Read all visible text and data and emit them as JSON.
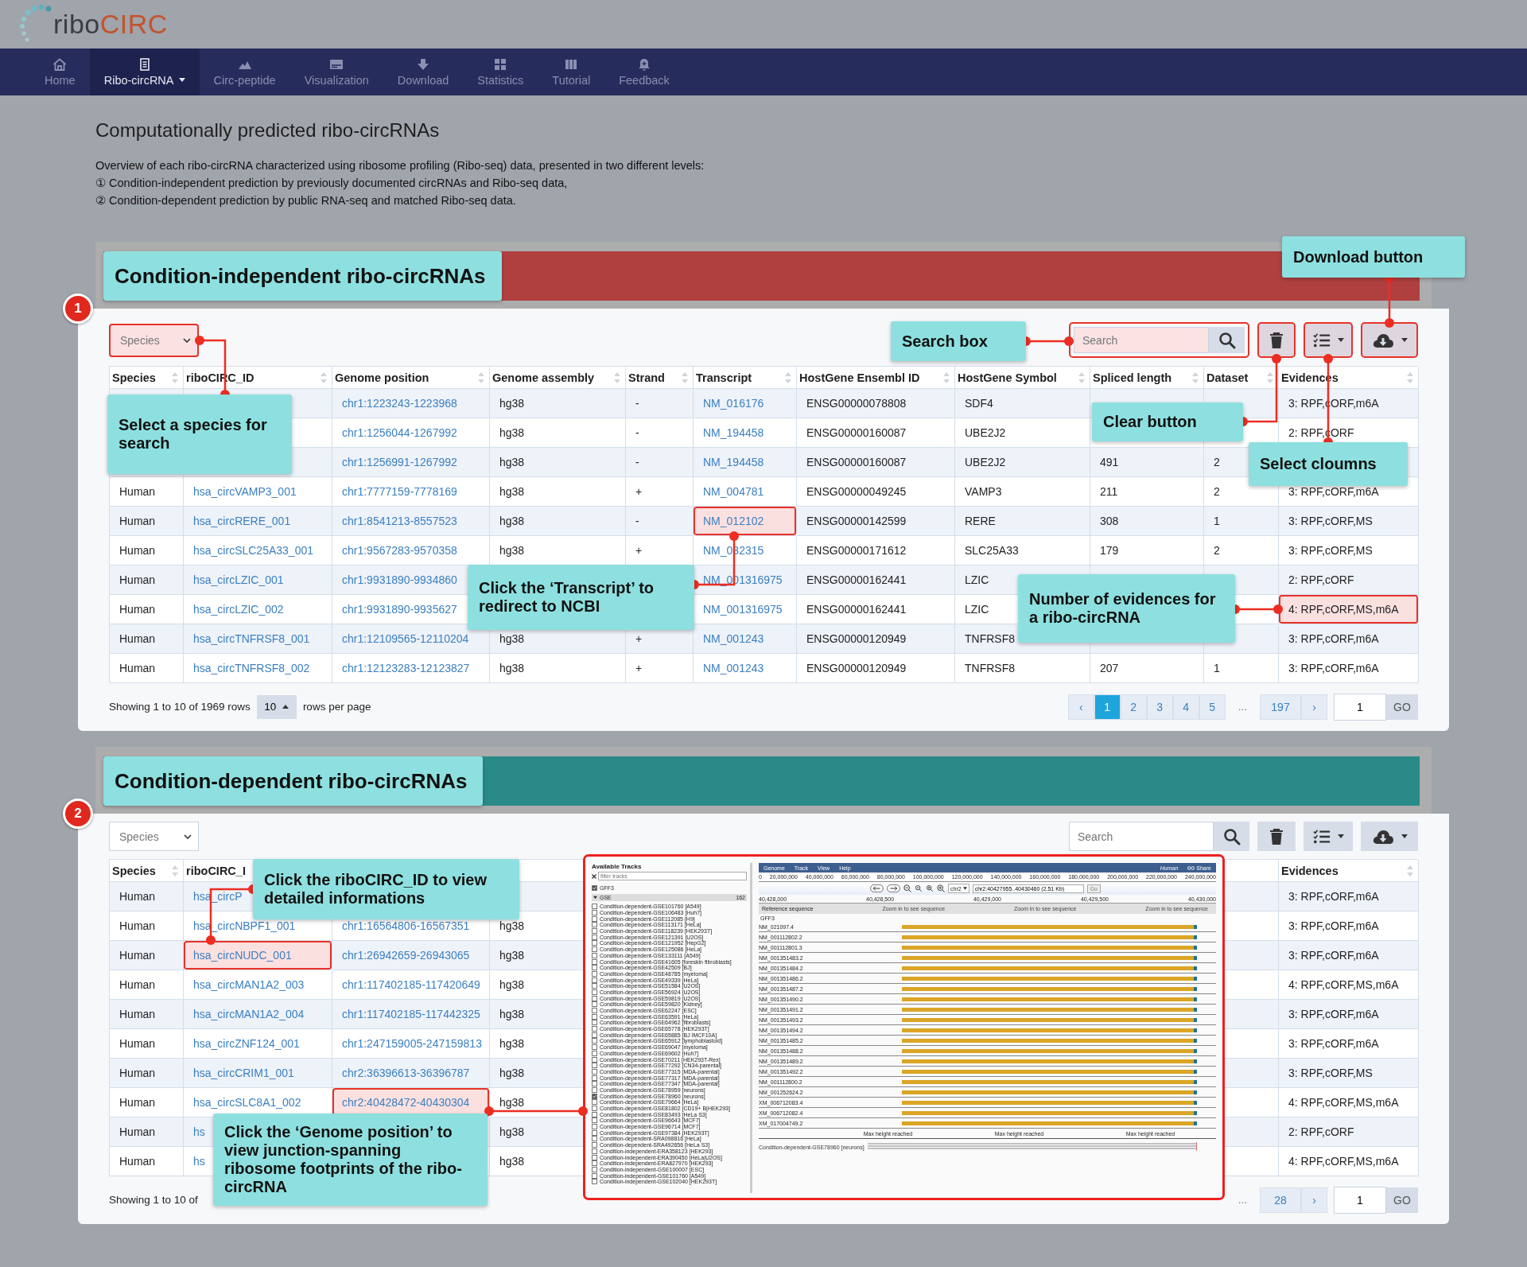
{
  "logo": {
    "prefix": "ribo",
    "suffix": "CIRC"
  },
  "nav": [
    {
      "label": "Home",
      "selected": false,
      "dropdown": false
    },
    {
      "label": "Ribo-circRNA",
      "selected": true,
      "dropdown": true
    },
    {
      "label": "Circ-peptide",
      "selected": false,
      "dropdown": false
    },
    {
      "label": "Visualization",
      "selected": false,
      "dropdown": false
    },
    {
      "label": "Download",
      "selected": false,
      "dropdown": false
    },
    {
      "label": "Statistics",
      "selected": false,
      "dropdown": false
    },
    {
      "label": "Tutorial",
      "selected": false,
      "dropdown": false
    },
    {
      "label": "Feedback",
      "selected": false,
      "dropdown": false
    }
  ],
  "page_title": "Computationally predicted ribo-circRNAs",
  "intro": [
    "Overview of each ribo-circRNA characterized using ribosome profiling (Ribo-seq) data, presented in two different levels:",
    "① Condition-independent prediction by previously documented circRNAs and Ribo-seq data,",
    "② Condition-dependent prediction by public RNA-seq and matched Ribo-seq data."
  ],
  "sections": [
    {
      "badge": "1",
      "title": "Condition-independent ribo-circRNAs",
      "color": "#b04040",
      "species_select": {
        "placeholder": "Species",
        "highlighted": true
      },
      "search": {
        "placeholder": "Search",
        "highlighted": true
      },
      "tools": [
        {
          "kind": "clear",
          "highlighted": true
        },
        {
          "kind": "columns",
          "highlighted": true
        },
        {
          "kind": "download",
          "highlighted": true
        }
      ],
      "columns": [
        "Species",
        "riboCIRC_ID",
        "Genome position",
        "Genome assembly",
        "Strand",
        "Transcript",
        "HostGene Ensembl ID",
        "HostGene Symbol",
        "Spliced length",
        "Dataset",
        "Evidences"
      ],
      "rows": [
        [
          null,
          null,
          "chr1:1223243-1223968",
          "hg38",
          "-",
          "NM_016176",
          "ENSG00000078808",
          "SDF4",
          null,
          null,
          "3: RPF,cORF,m6A"
        ],
        [
          null,
          null,
          "chr1:1256044-1267992",
          "hg38",
          "-",
          "NM_194458",
          "ENSG00000160087",
          "UBE2J2",
          null,
          null,
          "2: RPF,cORF"
        ],
        [
          null,
          null,
          "chr1:1256991-1267992",
          "hg38",
          "-",
          "NM_194458",
          "ENSG00000160087",
          "UBE2J2",
          "491",
          "2",
          null
        ],
        [
          "Human",
          "hsa_circVAMP3_001",
          "chr1:7777159-7778169",
          "hg38",
          "+",
          "NM_004781",
          "ENSG00000049245",
          "VAMP3",
          "211",
          "2",
          "3: RPF,cORF,m6A"
        ],
        [
          "Human",
          "hsa_circRERE_001",
          "chr1:8541213-8557523",
          "hg38",
          "-",
          {
            "text": "NM_012102",
            "highlighted": true
          },
          "ENSG00000142599",
          "RERE",
          "308",
          "1",
          "3: RPF,cORF,MS"
        ],
        [
          "Human",
          "hsa_circSLC25A33_001",
          "chr1:9567283-9570358",
          "hg38",
          "+",
          "NM_032315",
          "ENSG00000171612",
          "SLC25A33",
          "179",
          "2",
          "3: RPF,cORF,MS"
        ],
        [
          "Human",
          "hsa_circLZIC_001",
          "chr1:9931890-9934860",
          null,
          null,
          "NM_001316975",
          "ENSG00000162441",
          "LZIC",
          null,
          null,
          "2: RPF,cORF"
        ],
        [
          "Human",
          "hsa_circLZIC_002",
          "chr1:9931890-9935627",
          null,
          null,
          "NM_001316975",
          "ENSG00000162441",
          "LZIC",
          null,
          null,
          {
            "text": "4: RPF,cORF,MS,m6A",
            "highlighted": true
          }
        ],
        [
          "Human",
          "hsa_circTNFRSF8_001",
          "chr1:12109565-12110204",
          "hg38",
          "+",
          "NM_001243",
          "ENSG00000120949",
          "TNFRSF8",
          null,
          null,
          "3: RPF,cORF,m6A"
        ],
        [
          "Human",
          "hsa_circTNFRSF8_002",
          "chr1:12123283-12123827",
          "hg38",
          "+",
          "NM_001243",
          "ENSG00000120949",
          "TNFRSF8",
          "207",
          "1",
          "3: RPF,cORF,m6A"
        ]
      ],
      "pagination": {
        "summary_start": "Showing 1 to 10 of 1969 rows",
        "page_size": "10",
        "summary_end": "rows per page",
        "prev": "‹",
        "pages": [
          {
            "label": "1",
            "selected": true
          },
          {
            "label": "2",
            "selected": false
          },
          {
            "label": "3",
            "selected": false
          },
          {
            "label": "4",
            "selected": false
          },
          {
            "label": "5",
            "selected": false
          }
        ],
        "ellipsis": "...",
        "last": "197",
        "next": "›",
        "goto_value": "1",
        "go": "GO"
      }
    },
    {
      "badge": "2",
      "title": "Condition-dependent ribo-circRNAs",
      "color": "#2a8a88",
      "species_select": {
        "placeholder": "Species",
        "highlighted": false
      },
      "search": {
        "placeholder": "Search",
        "highlighted": false
      },
      "tools": [
        {
          "kind": "clear",
          "highlighted": false
        },
        {
          "kind": "columns",
          "highlighted": false
        },
        {
          "kind": "download",
          "highlighted": false
        }
      ],
      "columns": [
        "Species",
        "riboCIRC_I",
        null,
        null,
        null,
        null,
        null,
        null,
        null,
        null,
        "Evidences"
      ],
      "rows": [
        [
          "Human",
          "hsa_circP",
          null,
          null,
          null,
          null,
          null,
          null,
          null,
          null,
          "3: RPF,cORF,m6A"
        ],
        [
          "Human",
          "hsa_circNBPF1_001",
          "chr1:16564806-16567351",
          "hg38",
          null,
          null,
          null,
          null,
          null,
          null,
          "3: RPF,cORF,m6A"
        ],
        [
          "Human",
          {
            "text": "hsa_circNUDC_001",
            "highlighted": true
          },
          "chr1:26942659-26943065",
          "hg38",
          null,
          null,
          null,
          null,
          null,
          null,
          "3: RPF,cORF,m6A"
        ],
        [
          "Human",
          "hsa_circMAN1A2_003",
          "chr1:117402185-117420649",
          "hg38",
          null,
          null,
          null,
          null,
          null,
          null,
          "4: RPF,cORF,MS,m6A"
        ],
        [
          "Human",
          "hsa_circMAN1A2_004",
          "chr1:117402185-117442325",
          "hg38",
          null,
          null,
          null,
          null,
          null,
          null,
          "3: RPF,cORF,m6A"
        ],
        [
          "Human",
          "hsa_circZNF124_001",
          "chr1:247159005-247159813",
          "hg38",
          null,
          null,
          null,
          null,
          null,
          null,
          "3: RPF,cORF,m6A"
        ],
        [
          "Human",
          "hsa_circCRIM1_001",
          "chr2:36396613-36396787",
          "hg38",
          null,
          null,
          null,
          null,
          null,
          null,
          "3: RPF,cORF,MS"
        ],
        [
          "Human",
          "hsa_circSLC8A1_002",
          {
            "text": "chr2:40428472-40430304",
            "highlighted": true
          },
          "hg38",
          null,
          null,
          null,
          null,
          null,
          null,
          "4: RPF,cORF,MS,m6A"
        ],
        [
          "Human",
          "hs",
          null,
          "hg38",
          null,
          null,
          null,
          null,
          null,
          null,
          "2: RPF,cORF"
        ],
        [
          "Human",
          "hs",
          null,
          "hg38",
          null,
          null,
          null,
          null,
          null,
          null,
          "4: RPF,cORF,MS,m6A"
        ]
      ],
      "pagination": {
        "summary_start": "Showing 1 to 10 of",
        "ellipsis": "...",
        "last": "28",
        "next": "›",
        "goto_value": "1",
        "go": "GO"
      }
    }
  ],
  "annotations": [
    {
      "text": "Download button"
    },
    {
      "text": "Search box"
    },
    {
      "text": "Select a species for search"
    },
    {
      "text": "Clear button"
    },
    {
      "text": "Select cloumns"
    },
    {
      "text": "Click the ‘Transcript’ to redirect to NCBI"
    },
    {
      "text": "Number of evidences for a ribo-circRNA"
    },
    {
      "text": "Click the riboCIRC_ID to view detailed informations"
    },
    {
      "text": "Click the ‘Genome position’ to view junction-spanning ribosome footprints of the ribo-circRNA"
    }
  ],
  "genome_browser": {
    "tracks_title": "Available Tracks",
    "filter_placeholder": "filter tracks",
    "gff3": {
      "label": "GFF3",
      "checked": true
    },
    "group": {
      "label": "GSE",
      "count": "162",
      "expanded": true
    },
    "tracks": [
      {
        "label": "Condition-dependent-GSE101760 [A549]",
        "checked": false
      },
      {
        "label": "Condition-dependent-GSE106483 [Huh7]",
        "checked": false
      },
      {
        "label": "Condition-dependent-GSE112085 [H9]",
        "checked": false
      },
      {
        "label": "Condition-dependent-GSE113171 [HeLa]",
        "checked": false
      },
      {
        "label": "Condition-dependent-GSE118239 [HEK293T]",
        "checked": false
      },
      {
        "label": "Condition-dependent-GSE121391 [U2OS]",
        "checked": false
      },
      {
        "label": "Condition-dependent-GSE121952 [HepG2]",
        "checked": false
      },
      {
        "label": "Condition-dependent-GSE125086 [HeLa]",
        "checked": false
      },
      {
        "label": "Condition-dependent-GSE133111 [A549]",
        "checked": false
      },
      {
        "label": "Condition-dependent-GSE41605 [foreskin fibroblasts]",
        "checked": false
      },
      {
        "label": "Condition-dependent-GSE42509 [BJ]",
        "checked": false
      },
      {
        "label": "Condition-dependent-GSE48785 [myeloma]",
        "checked": false
      },
      {
        "label": "Condition-dependent-GSE49339 [HeLa]",
        "checked": false
      },
      {
        "label": "Condition-dependent-GSE51584 [U2OS]",
        "checked": false
      },
      {
        "label": "Condition-dependent-GSE56924 [U2OS]",
        "checked": false
      },
      {
        "label": "Condition-dependent-GSE59819 [U2OS]",
        "checked": false
      },
      {
        "label": "Condition-dependent-GSE59820 [Kidney]",
        "checked": false
      },
      {
        "label": "Condition-dependent-GSE62247 [ESC]",
        "checked": false
      },
      {
        "label": "Condition-dependent-GSE63591 [HeLa]",
        "checked": false
      },
      {
        "label": "Condition-dependent-GSE64962 [fibroblasts]",
        "checked": false
      },
      {
        "label": "Condition-dependent-GSE65778 [HEK293T]",
        "checked": false
      },
      {
        "label": "Condition-dependent-GSE65885 [BJ IMCF10A]",
        "checked": false
      },
      {
        "label": "Condition-dependent-GSE65912 [lymphoblastoid]",
        "checked": false
      },
      {
        "label": "Condition-dependent-GSE69047 [myeloma]",
        "checked": false
      },
      {
        "label": "Condition-dependent-GSE69602 [Huh7]",
        "checked": false
      },
      {
        "label": "Condition-dependent-GSE70211 [HEK293T-Rex]",
        "checked": false
      },
      {
        "label": "Condition-dependent-GSE77292 [CN34-parental]",
        "checked": false
      },
      {
        "label": "Condition-dependent-GSE77315 [MDA-parental]",
        "checked": false
      },
      {
        "label": "Condition-dependent-GSE77317 [MDA-parental]",
        "checked": false
      },
      {
        "label": "Condition-dependent-GSE77347 [MDA-parental]",
        "checked": false
      },
      {
        "label": "Condition-dependent-GSE78959 [neurons]",
        "checked": false
      },
      {
        "label": "Condition-dependent-GSE78960 [neurons]",
        "checked": true
      },
      {
        "label": "Condition-dependent-GSE79664 [HeLa]",
        "checked": false
      },
      {
        "label": "Condition-dependent-GSE81802 [CD19+ B|HEK293]",
        "checked": false
      },
      {
        "label": "Condition-dependent-GSE83493 [HeLa S3]",
        "checked": false
      },
      {
        "label": "Condition-dependent-GSE96643 [MCF7]",
        "checked": false
      },
      {
        "label": "Condition-dependent-GSE96714 [MCF7]",
        "checked": false
      },
      {
        "label": "Condition-dependent-GSE97384 [HEK293T]",
        "checked": false
      },
      {
        "label": "Condition-dependent-SRA098816 [HeLa]",
        "checked": false
      },
      {
        "label": "Condition-dependent-SRA492656 [HeLa S3]",
        "checked": false
      },
      {
        "label": "Condition-independent-ERA358123 [HEK293]",
        "checked": false
      },
      {
        "label": "Condition-independent-ERA390450 [HeLa|U2OS]",
        "checked": false
      },
      {
        "label": "Condition-independent-ERA827970 [HEK293]",
        "checked": false
      },
      {
        "label": "Condition-independent-GSE100007 [ESC]",
        "checked": false
      },
      {
        "label": "Condition-independent-GSE101760 [A549]",
        "checked": false
      },
      {
        "label": "Condition-independent-GSE102040 [HEK293T]",
        "checked": false
      }
    ],
    "menu": [
      "Genome",
      "Track",
      "View",
      "Help"
    ],
    "species": "Human",
    "share": "Share",
    "overview_ticks": [
      "0",
      "20,000,000",
      "40,000,000",
      "60,000,000",
      "80,000,000",
      "100,000,000",
      "120,000,000",
      "140,000,000",
      "160,000,000",
      "180,000,000",
      "200,000,000",
      "220,000,000",
      "240,000,000"
    ],
    "chromosome": "chr2",
    "location": "chr2:40427955..40430460 (2.51 Kb)",
    "go": "Go",
    "detail_ticks": [
      "40,428,000",
      "40,428,500",
      "40,429,000",
      "40,429,500",
      "40,430,000"
    ],
    "reference_label": "Reference sequence",
    "sequence_hints": [
      "Zoom in to see sequence",
      "Zoom in to see sequence",
      "Zoom in to see sequence"
    ],
    "gff3_track": "GFF3",
    "transcripts": [
      "NM_021097.4",
      "NM_001112802.2",
      "NM_001112801.3",
      "NM_001351483.2",
      "NM_001351484.2",
      "NM_001351486.2",
      "NM_001351487.2",
      "NM_001351490.2",
      "NM_001351491.2",
      "NM_001351493.2",
      "NM_001351494.2",
      "NM_001351485.2",
      "NM_001351488.2",
      "NM_001351489.2",
      "NM_001351492.2",
      "NM_001112800.2",
      "NM_001252624.2",
      "XM_006712083.4",
      "XM_006712082.4",
      "XM_017004749.2"
    ],
    "max_height": [
      "Max height reached",
      "Max height reached",
      "Max height reached"
    ],
    "coverage_track": "Condition-dependent-GSE78960 [neurons]"
  }
}
